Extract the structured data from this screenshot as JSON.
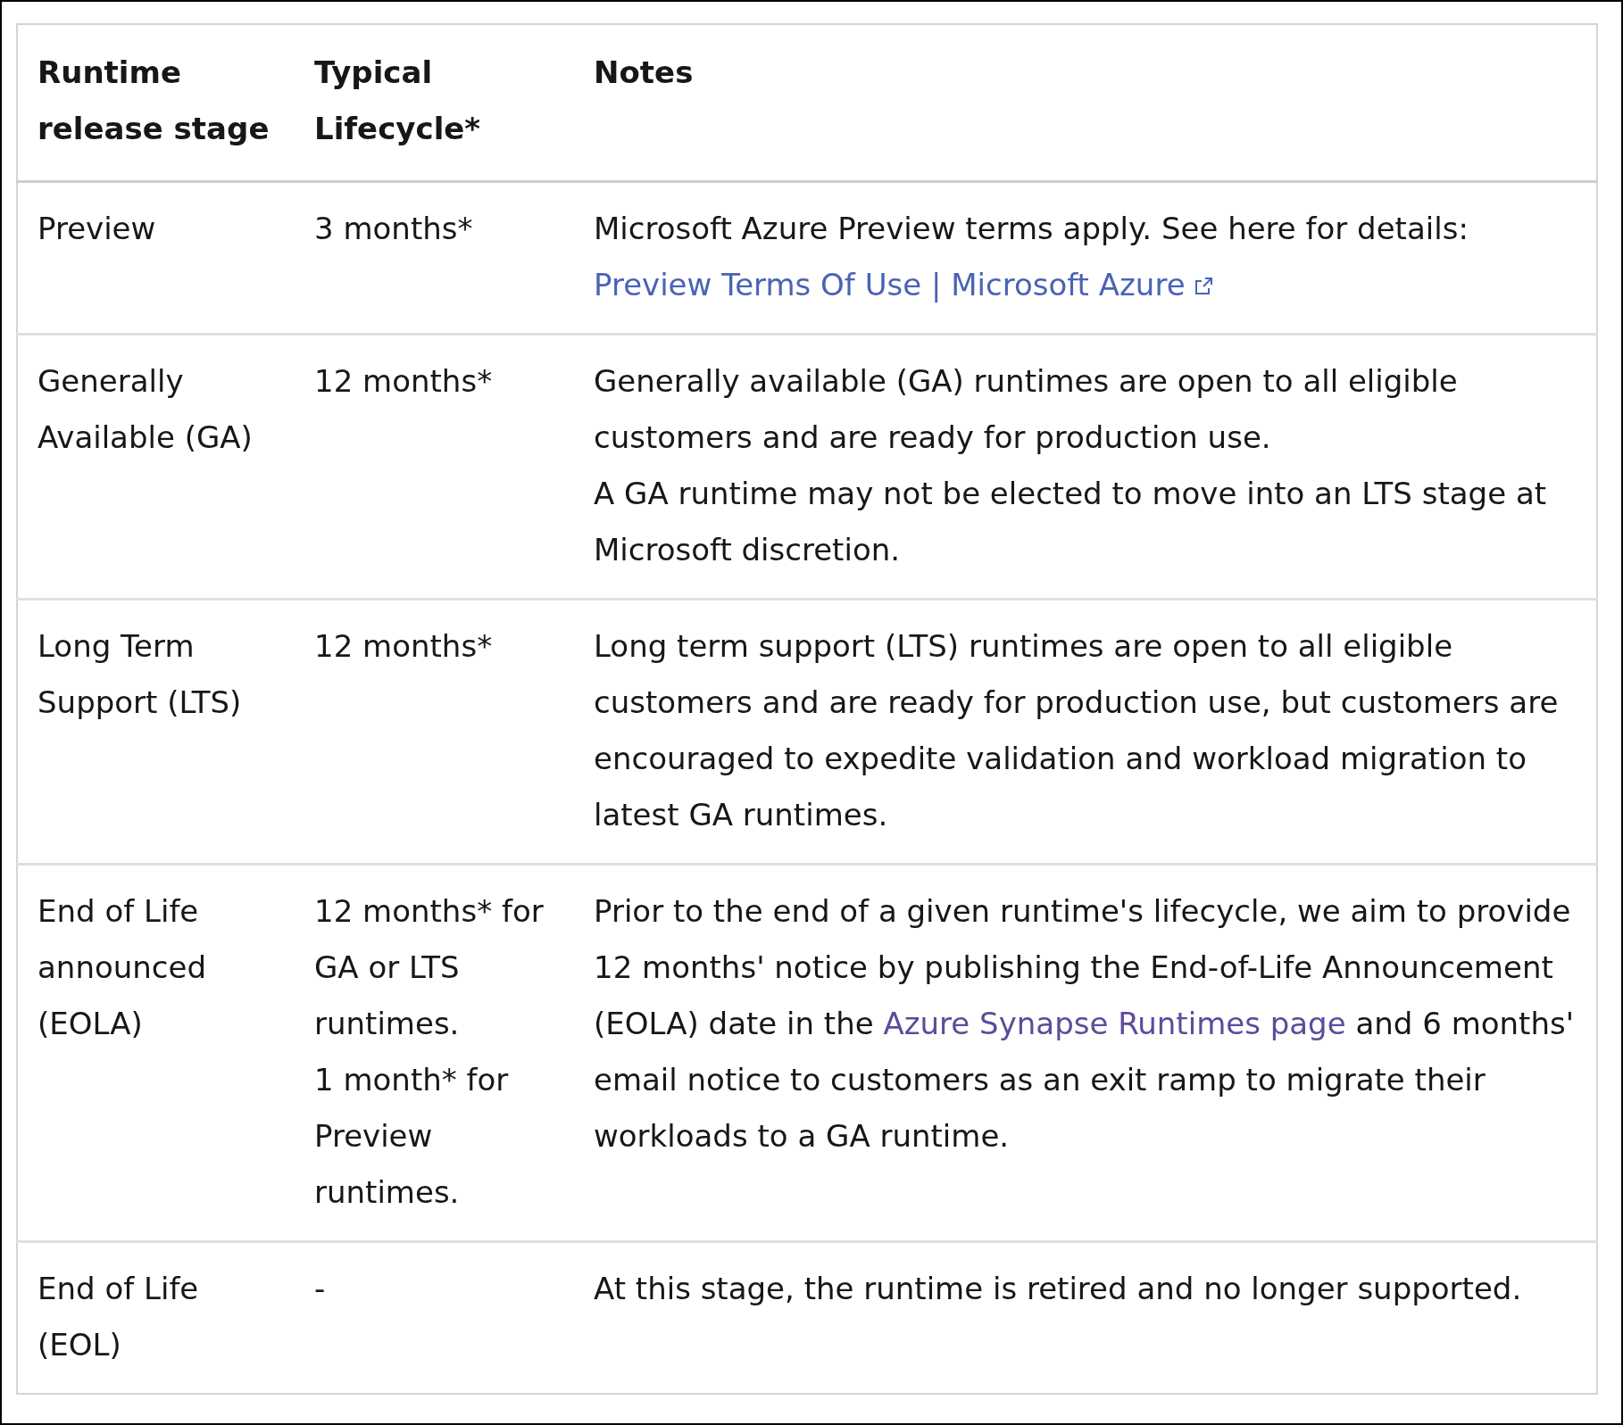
{
  "table": {
    "columns": [
      "Runtime release stage",
      "Typical Lifecycle*",
      "Notes"
    ],
    "rows": [
      {
        "stage": [
          "Preview"
        ],
        "lifecycle": [
          "3 months*"
        ],
        "notes": [
          [
            {
              "kind": "text",
              "text": "Microsoft Azure Preview terms apply. See here for details: "
            },
            {
              "kind": "link",
              "text": "Preview Terms Of Use | Microsoft Azure",
              "external": true,
              "visited": false
            }
          ]
        ]
      },
      {
        "stage": [
          "Generally Available (GA)"
        ],
        "lifecycle": [
          "12 months*"
        ],
        "notes": [
          [
            {
              "kind": "text",
              "text": "Generally available (GA) runtimes are open to all eligible customers and are ready for production use."
            }
          ],
          [
            {
              "kind": "text",
              "text": "A GA runtime may not be elected to move into an LTS stage at Microsoft discretion."
            }
          ]
        ]
      },
      {
        "stage": [
          "Long Term Support (LTS)"
        ],
        "lifecycle": [
          "12 months*"
        ],
        "notes": [
          [
            {
              "kind": "text",
              "text": "Long term support (LTS) runtimes are open to all eligible customers and are ready for production use, but customers are encouraged to expedite validation and workload migration to latest GA runtimes."
            }
          ]
        ]
      },
      {
        "stage": [
          "End of Life announced (EOLA)"
        ],
        "lifecycle": [
          "12 months* for GA or LTS runtimes.",
          "1 month* for Preview runtimes."
        ],
        "notes": [
          [
            {
              "kind": "text",
              "text": "Prior to the end of a given runtime's lifecycle, we aim to provide 12 months' notice by publishing the End-of-Life Announcement (EOLA) date in the "
            },
            {
              "kind": "link",
              "text": "Azure Synapse Runtimes page",
              "external": false,
              "visited": true
            },
            {
              "kind": "text",
              "text": " and 6 months' email notice to customers as an exit ramp to migrate their workloads to a GA runtime."
            }
          ]
        ]
      },
      {
        "stage": [
          "End of Life (EOL)"
        ],
        "lifecycle": [
          "-"
        ],
        "notes": [
          [
            {
              "kind": "text",
              "text": "At this stage, the runtime is retired and no longer supported."
            }
          ]
        ]
      }
    ]
  }
}
